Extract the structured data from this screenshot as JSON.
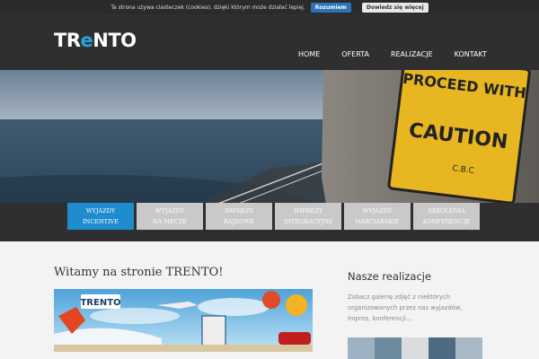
{
  "cookie": {
    "text": "Ta strona używa ciasteczek (cookies), dzięki którym może działać lepiej.",
    "accept_label": "Rozumiem",
    "more_label": "Dowiedz się więcej"
  },
  "logo": {
    "prefix": "TR",
    "accent": "e",
    "suffix": "NTO"
  },
  "nav": [
    "HOME",
    "OFERTA",
    "REALIZACJE",
    "KONTAKT"
  ],
  "hero": {
    "sign_line1": "PROCEED WITH",
    "sign_line2": "CAUTION",
    "sign_small": "C.B.C"
  },
  "categories": [
    {
      "label1": "WYJAZDY",
      "label2": "INCENTIVE",
      "active": true
    },
    {
      "label1": "WYJAZDY",
      "label2": "NA MECZE",
      "active": false
    },
    {
      "label1": "IMPREZY",
      "label2": "RAJDOWE",
      "active": false
    },
    {
      "label1": "IMPREZY",
      "label2": "INTEGRACYJNE",
      "active": false
    },
    {
      "label1": "WYJAZDY",
      "label2": "NARCIARSKIE",
      "active": false
    },
    {
      "label1": "SZKOLENIA",
      "label2": "KONFERENCJE",
      "active": false
    }
  ],
  "main": {
    "title": "Witamy na stronie TRENTO!",
    "banner_logo": "TRENTO"
  },
  "sidebar": {
    "title": "Nasze realizacje",
    "text": "Zobacz galerię zdjęć z niektórych organizowanych przez nas wyjazdów, imprez, konferencji..."
  },
  "colors": {
    "accent": "#1e8ccf",
    "header_bg": "#2f2f2f",
    "sign_yellow": "#e8b620"
  }
}
